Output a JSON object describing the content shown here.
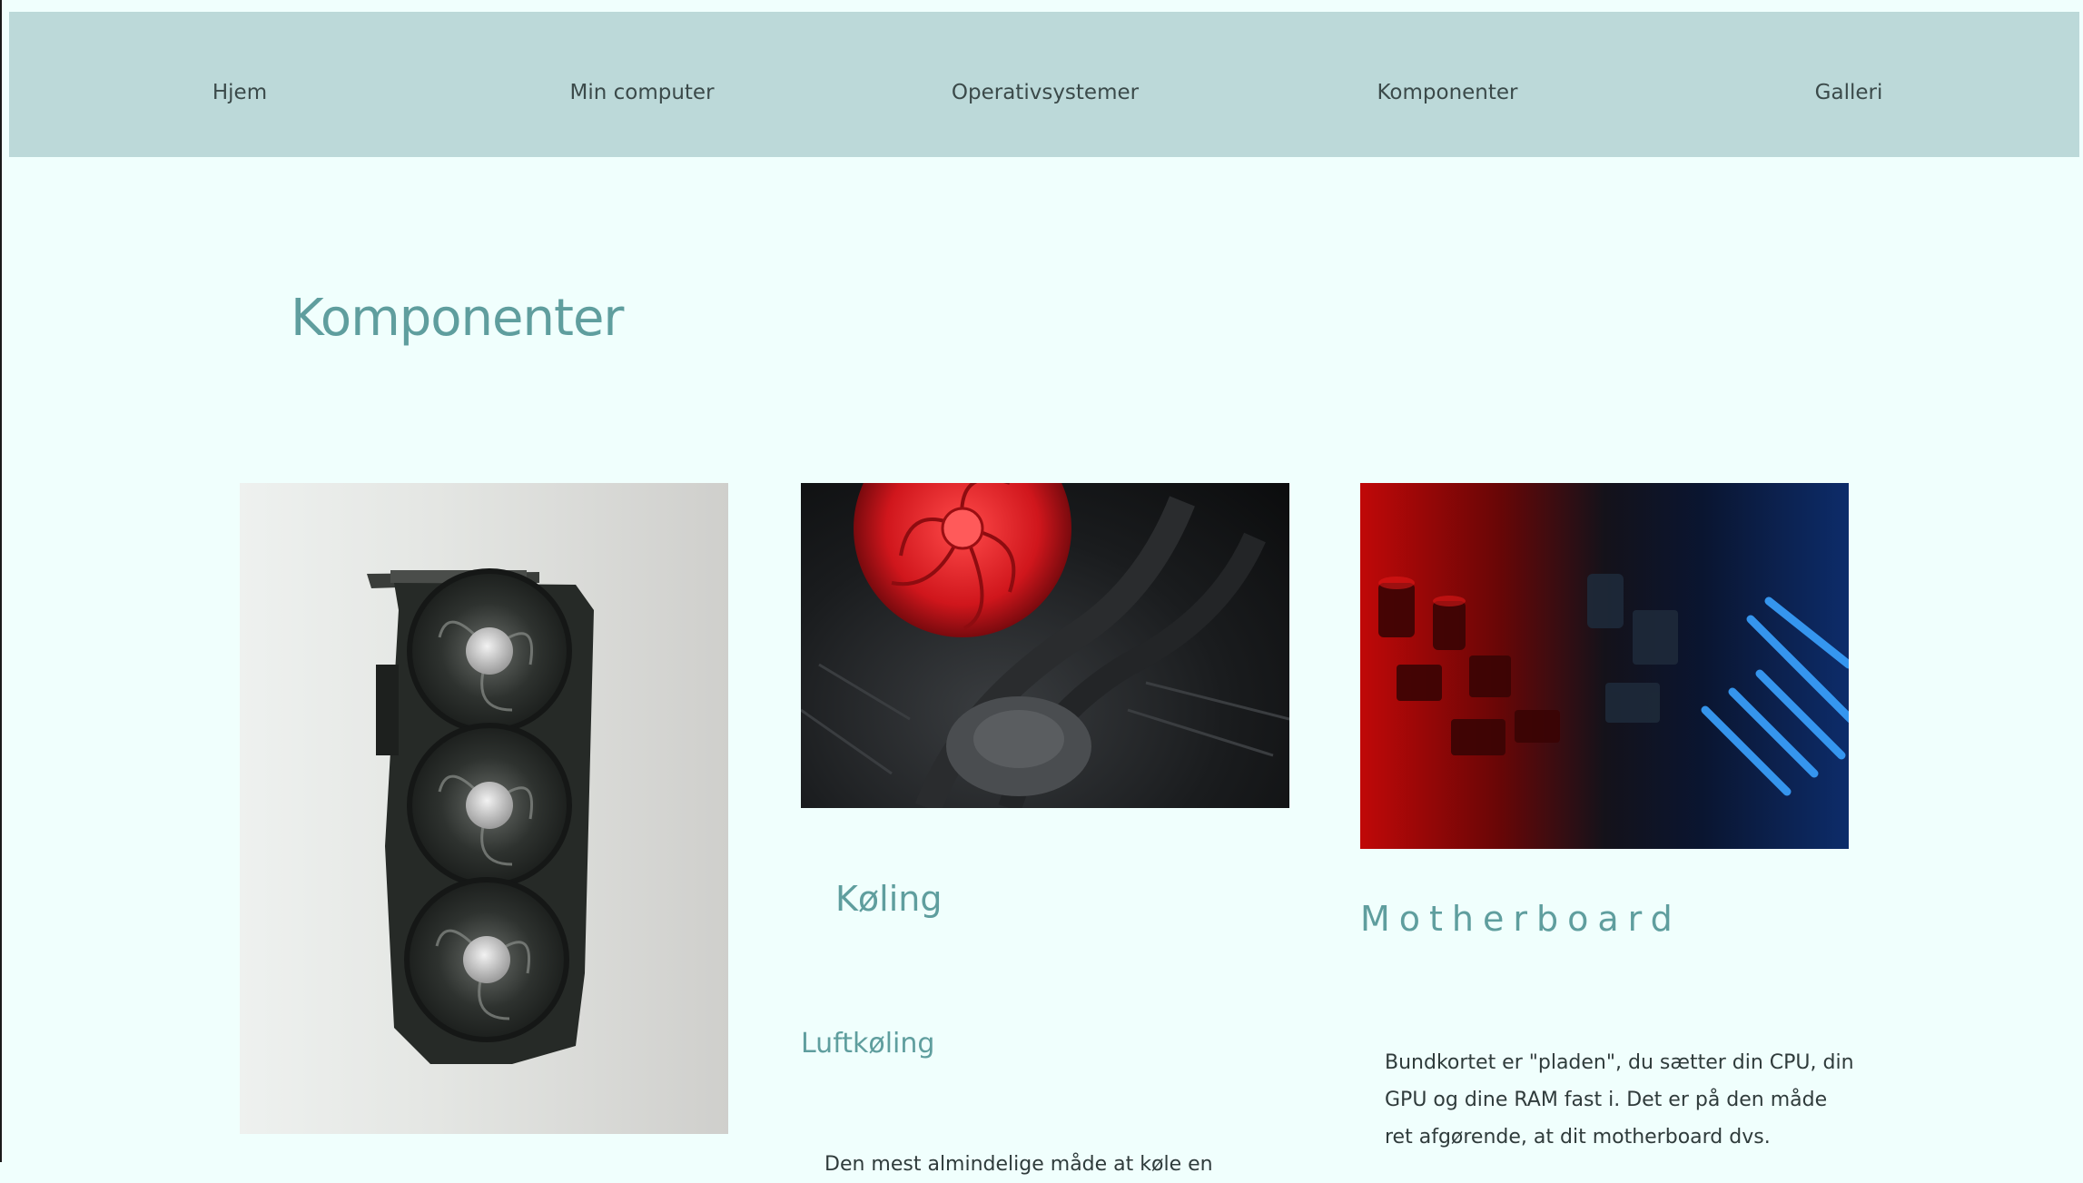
{
  "nav": {
    "items": [
      {
        "label": "Hjem"
      },
      {
        "label": "Min computer"
      },
      {
        "label": "Operativsystemer"
      },
      {
        "label": "Komponenter"
      },
      {
        "label": "Galleri"
      }
    ]
  },
  "page": {
    "title": "Komponenter"
  },
  "sections": {
    "cooling": {
      "title": "Køling",
      "subtitle": "Luftkøling",
      "text_partial": "Den mest almindelige måde at køle en"
    },
    "motherboard": {
      "title": "Motherboard",
      "text": "Bundkortet er \"pladen\", du sætter din CPU, din GPU og dine RAM fast i. Det er på den måde ret afgørende, at dit motherboard dvs."
    }
  },
  "colors": {
    "nav_bg": "#bcd9d9",
    "page_bg": "#f0fffd",
    "heading": "#5f9e9e"
  }
}
